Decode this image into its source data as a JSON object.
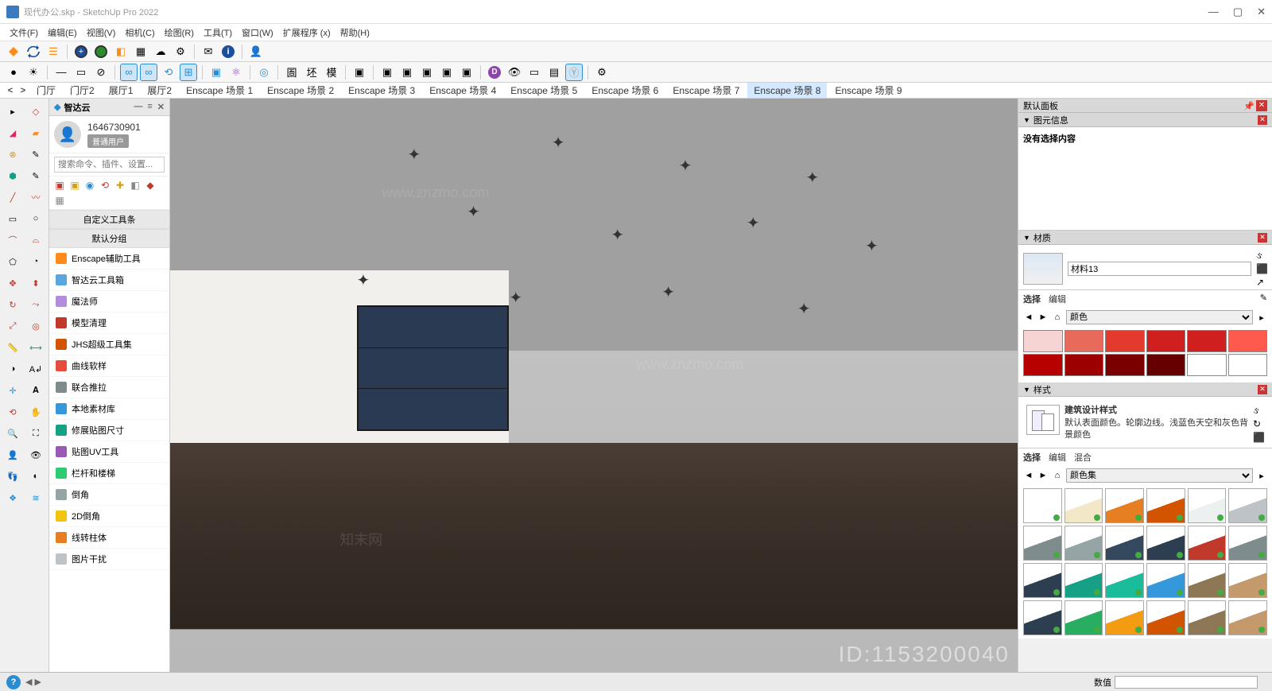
{
  "title": "现代办公.skp - SketchUp Pro 2022",
  "menu": [
    "文件(F)",
    "编辑(E)",
    "视图(V)",
    "相机(C)",
    "绘图(R)",
    "工具(T)",
    "窗口(W)",
    "扩展程序 (x)",
    "帮助(H)"
  ],
  "scenes": {
    "tabs": [
      "门厅",
      "门厅2",
      "展厅1",
      "展厅2",
      "Enscape 场景 1",
      "Enscape 场景 2",
      "Enscape 场景 3",
      "Enscape 场景 4",
      "Enscape 场景 5",
      "Enscape 场景 6",
      "Enscape 场景 7",
      "Enscape 场景 8",
      "Enscape 场景 9"
    ],
    "activeIndex": 11
  },
  "pluginPanel": {
    "title": "智达云",
    "user": {
      "id": "1646730901",
      "badge": "普通用户"
    },
    "searchPlaceholder": "搜索命令、插件、设置...",
    "section1": "自定义工具条",
    "section2": "默认分组",
    "items": [
      {
        "label": "Enscape辅助工具",
        "color": "#ff8c1a"
      },
      {
        "label": "智达云工具箱",
        "color": "#5aa7e0"
      },
      {
        "label": "魔法师",
        "color": "#b38bdf"
      },
      {
        "label": "模型清理",
        "color": "#c0392b"
      },
      {
        "label": "JHS超级工具集",
        "color": "#d35400"
      },
      {
        "label": "曲线软样",
        "color": "#e74c3c"
      },
      {
        "label": "联合推拉",
        "color": "#7f8c8d"
      },
      {
        "label": "本地素材库",
        "color": "#3498db"
      },
      {
        "label": "修展贴图尺寸",
        "color": "#16a085"
      },
      {
        "label": "贴图UV工具",
        "color": "#9b59b6"
      },
      {
        "label": "栏杆和楼梯",
        "color": "#2ecc71"
      },
      {
        "label": "倒角",
        "color": "#95a5a6"
      },
      {
        "label": "2D倒角",
        "color": "#f1c40f"
      },
      {
        "label": "线转柱体",
        "color": "#e67e22"
      },
      {
        "label": "图片干扰",
        "color": "#bdc3c7"
      }
    ]
  },
  "trayTitle": "默认面板",
  "entity": {
    "header": "图元信息",
    "empty": "没有选择内容"
  },
  "materials": {
    "header": "材质",
    "name": "材料13",
    "tabs": [
      "选择",
      "编辑"
    ],
    "dropdown": "颜色",
    "swatches": [
      "#f7d4d4",
      "#e86a5a",
      "#e23b2e",
      "#d01f1f",
      "#d01f1f",
      "#ff5a4d",
      "#b70000",
      "#9c0000",
      "#7a0000",
      "#660000",
      "#ffffff",
      "#ffffff"
    ]
  },
  "styles": {
    "header": "样式",
    "name": "建筑设计样式",
    "desc": "默认表面颜色。轮廓边线。浅蓝色天空和灰色背景颜色",
    "tabs": [
      "选择",
      "编辑",
      "混合"
    ],
    "dropdown": "颜色集",
    "cells": [
      "#ffffff",
      "#f2e8c8",
      "#e67e22",
      "#d35400",
      "#ecf0f1",
      "#bdc3c7",
      "#7f8c8d",
      "#95a5a6",
      "#34495e",
      "#2c3e50",
      "#c0392b",
      "#7f8c8d",
      "#2c3e50",
      "#16a085",
      "#1abc9c",
      "#3498db",
      "#8e7755",
      "#c49a6c",
      "#2c3e50",
      "#27ae60",
      "#f39c12",
      "#d35400",
      "#8e7755",
      "#c49a6c"
    ]
  },
  "overlayId": "ID:1153200040",
  "status": {
    "label": "数值"
  }
}
